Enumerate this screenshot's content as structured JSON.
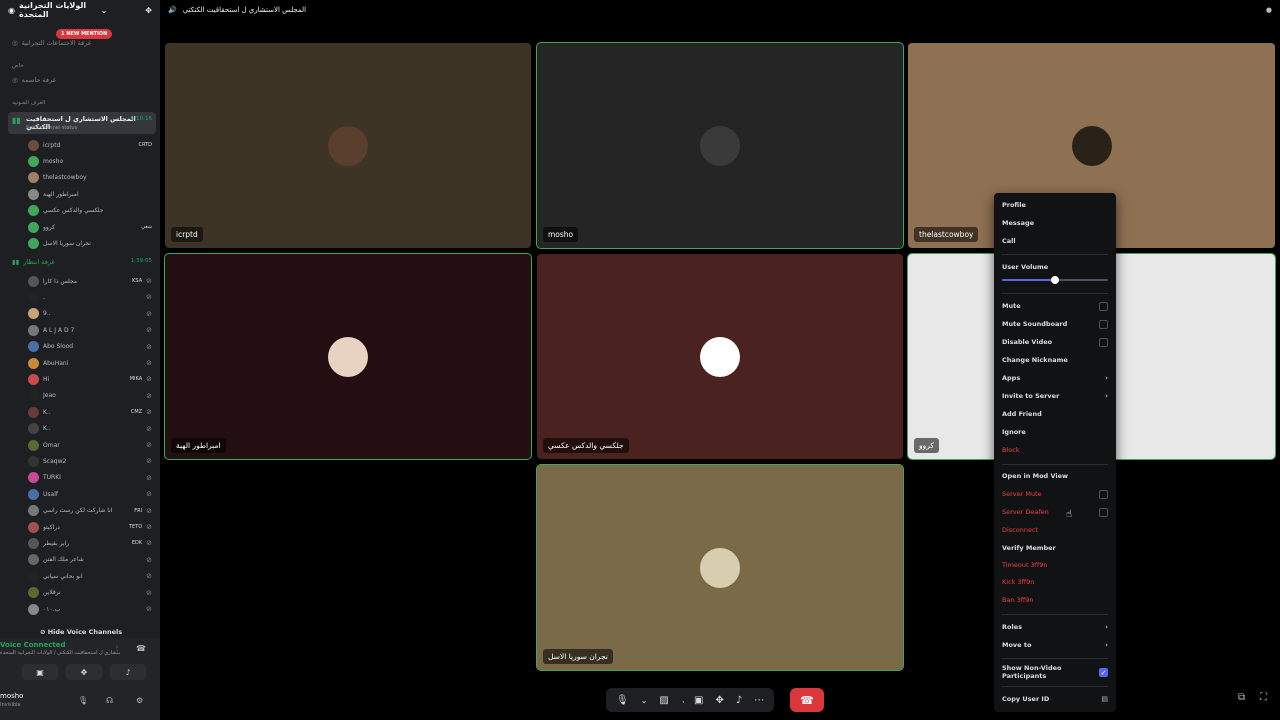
{
  "server": {
    "name": "الولايات التجرانية المتحدة",
    "mention_badge": "1 NEW MENTION"
  },
  "channels": {
    "announce": "غرفة الاجتماعات التجرانية",
    "private_category": "خاص",
    "private_room": "غرفة حاسمه",
    "voice_category": "الغرف الصوتيه"
  },
  "active_voice": {
    "name": "المجلس الاستشاري ل استحقاقيت الكتكتي",
    "status": "Set a channel status",
    "timer": "1:10:16"
  },
  "active_members": [
    {
      "name": "icrptd",
      "tag": "CRTD",
      "color": "#6b4e3a"
    },
    {
      "name": "mosho",
      "tag": "",
      "color": "#3fa65a"
    },
    {
      "name": "thelastcowboy",
      "tag": "",
      "color": "#a08060"
    },
    {
      "name": "امبراطور الهبة",
      "tag": "",
      "color": "#888"
    },
    {
      "name": "جلكسي والدكس عكسي",
      "tag": "",
      "color": "#3fa65a"
    },
    {
      "name": "كروو",
      "tag": "شغي",
      "color": "#3fa65a"
    },
    {
      "name": "نجران سوريا الاسل",
      "tag": "",
      "color": "#3fa65a"
    }
  ],
  "second_voice": {
    "name": "غرفة انتظار",
    "timer": "1:39:05"
  },
  "second_members": [
    {
      "name": "مجلس ذا كارا",
      "tag": "KSA",
      "color": "#555"
    },
    {
      "name": ".",
      "tag": "",
      "color": "#222"
    },
    {
      "name": "9..",
      "tag": "",
      "color": "#c9a27a"
    },
    {
      "name": "A L J A D 7",
      "tag": "",
      "color": "#777"
    },
    {
      "name": "Abo Slood",
      "tag": "",
      "color": "#4a6fa5"
    },
    {
      "name": "AbuHani",
      "tag": "",
      "color": "#c88a3a"
    },
    {
      "name": "Hi",
      "tag": "MIKA",
      "color": "#c94a4a"
    },
    {
      "name": "Jeao",
      "tag": "",
      "color": "#222"
    },
    {
      "name": "K..",
      "tag": "CMZ",
      "color": "#6a3a3a"
    },
    {
      "name": "K..",
      "tag": "",
      "color": "#444"
    },
    {
      "name": "Omar",
      "tag": "",
      "color": "#556b2f"
    },
    {
      "name": "Scaqw2",
      "tag": "",
      "color": "#333"
    },
    {
      "name": "TURKI",
      "tag": "",
      "color": "#c94a9a"
    },
    {
      "name": "Usalf",
      "tag": "",
      "color": "#4a6fa5"
    },
    {
      "name": "انا شاركت لكن رست راسي",
      "tag": "FRI",
      "color": "#777"
    },
    {
      "name": "دراكيتو",
      "tag": "TETO",
      "color": "#a05050"
    },
    {
      "name": "رابر بفيطر",
      "tag": "EDK",
      "color": "#555"
    },
    {
      "name": "شاعر ملك الفتن",
      "tag": "",
      "color": "#666"
    },
    {
      "name": "انو بحاني سياني",
      "tag": "",
      "color": "#222"
    },
    {
      "name": "نرقلاين",
      "tag": "",
      "color": "#556b2f"
    },
    {
      "name": "ب.٠١٠",
      "tag": "",
      "color": "#888"
    }
  ],
  "hide_voice": "Hide Voice Channels",
  "voice_connected": {
    "title": "Voice Connected",
    "sub": "المجلس الاستشاري ل استحقاقيت الكتكتي / الولايات التجرانية المتحدة"
  },
  "user": {
    "name": "mosho",
    "status": "Invisible"
  },
  "call_title": "المجلس الاستشاري ل استحقاقيت الكتكتي",
  "tiles": [
    {
      "name": "icrptd",
      "bg": "#3e3425",
      "avatar": "#5a3e2e"
    },
    {
      "name": "mosho",
      "bg": "#252525",
      "avatar": "#3a3a3a"
    },
    {
      "name": "thelastcowboy",
      "bg": "#8e7052",
      "avatar": "#2a2218"
    },
    {
      "name": "امبراطور الهبة",
      "bg": "#230f12",
      "avatar": "#e8d2c2"
    },
    {
      "name": "جلكسي والدكس عكسي",
      "bg": "#4a2320",
      "avatar": "#ffffff"
    },
    {
      "name": "كروو",
      "bg": "#e8e8e8",
      "avatar": "#e8e8e8"
    },
    {
      "name": "نجران سوريا الاسل",
      "bg": "#7a6a48",
      "avatar": "#d8cdb0"
    }
  ],
  "menu": {
    "profile": "Profile",
    "message": "Message",
    "call": "Call",
    "user_volume": "User Volume",
    "volume_level": 50,
    "mute": "Mute",
    "mute_soundboard": "Mute Soundboard",
    "disable_video": "Disable Video",
    "change_nickname": "Change Nickname",
    "apps": "Apps",
    "invite": "Invite to Server",
    "add_friend": "Add Friend",
    "ignore": "Ignore",
    "block": "Block",
    "mod_view": "Open in Mod View",
    "server_mute": "Server Mute",
    "server_deafen": "Server Deafen",
    "disconnect": "Disconnect",
    "verify": "Verify Member",
    "timeout": "Timeout 3ff9n",
    "kick": "Kick 3ff9n",
    "ban": "Ban 3ff9n",
    "roles": "Roles",
    "move_to": "Move to",
    "show_non_video": "Show Non-Video Participants",
    "copy_id": "Copy User ID"
  }
}
